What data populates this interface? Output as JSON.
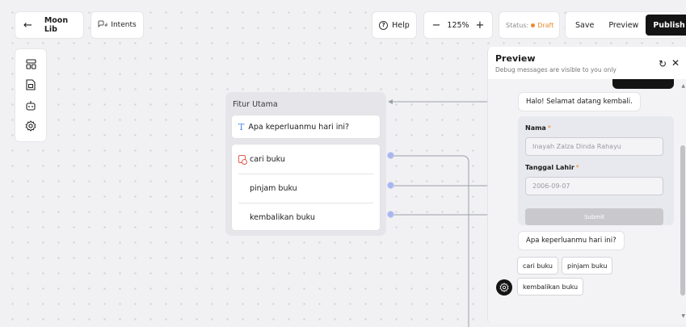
{
  "topbar": {
    "back_icon": "back-arrow-icon",
    "bot_name": "Moon Lib",
    "intents_icon": "intents-icon",
    "intents_label": "Intents",
    "help_label": "Help",
    "zoom_out": "−",
    "zoom_value": "125%",
    "zoom_in": "+",
    "status_label": "Status:",
    "status_value": "Draft",
    "status_color": "#e98a2e",
    "save_label": "Save",
    "preview_label": "Preview",
    "publish_label": "Publish"
  },
  "toolbar": {
    "items": [
      "layout-icon",
      "document-export-icon",
      "bot-icon",
      "settings-icon"
    ]
  },
  "node": {
    "title": "Fitur Utama",
    "question": "Apa keperluanmu hari ini?",
    "options": [
      "cari buku",
      "pinjam buku",
      "kembalikan buku"
    ]
  },
  "preview": {
    "title": "Preview",
    "subtitle": "Debug messages are visible to you only",
    "greeting": "Halo! Selamat datang kembali.",
    "form": {
      "fields": [
        {
          "label": "Nama",
          "value": "Inayah Zalza Dinda Rahayu"
        },
        {
          "label": "Tanggal Lahir",
          "value": "2006-09-07"
        }
      ],
      "required_mark": "*",
      "submit": "Submit"
    },
    "question": "Apa keperluanmu hari ini?",
    "choices": [
      "cari buku",
      "pinjam buku",
      "kembalikan buku"
    ]
  },
  "colors": {
    "accent_dark": "#141414",
    "port": "#a9b6ee",
    "option_icon": "#e25a4a"
  }
}
